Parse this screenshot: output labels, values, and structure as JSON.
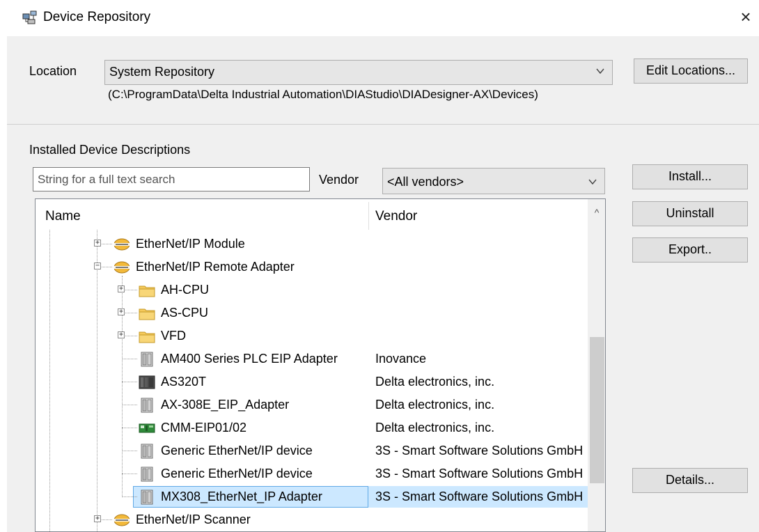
{
  "window": {
    "title": "Device Repository",
    "close_glyph": "×",
    "icon": "device-repository-icon"
  },
  "location": {
    "label": "Location",
    "selected": "System Repository",
    "path": "(C:\\ProgramData\\Delta Industrial Automation\\DIAStudio\\DIADesigner-AX\\Devices)",
    "edit_button": "Edit Locations..."
  },
  "installed": {
    "section_label": "Installed Device Descriptions",
    "search_placeholder": "String for a full text search",
    "vendor_label": "Vendor",
    "vendor_selected": "<All vendors>"
  },
  "buttons": {
    "install": "Install...",
    "uninstall": "Uninstall",
    "export": "Export..",
    "details": "Details..."
  },
  "tree": {
    "columns": {
      "name": "Name",
      "vendor": "Vendor"
    },
    "rows": [
      {
        "label": "EtherNet/IP Module",
        "vendor": "",
        "icon": "ethernet-ip-icon",
        "expander": "+"
      },
      {
        "label": "EtherNet/IP Remote Adapter",
        "vendor": "",
        "icon": "ethernet-ip-icon",
        "expander": "-"
      },
      {
        "label": "AH-CPU",
        "vendor": "",
        "icon": "folder-icon",
        "expander": "+"
      },
      {
        "label": "AS-CPU",
        "vendor": "",
        "icon": "folder-icon",
        "expander": "+"
      },
      {
        "label": "VFD",
        "vendor": "",
        "icon": "folder-icon",
        "expander": "+"
      },
      {
        "label": "AM400 Series PLC EIP Adapter",
        "vendor": "Inovance",
        "icon": "device-module-icon",
        "expander": ""
      },
      {
        "label": "AS320T",
        "vendor": "Delta electronics, inc.",
        "icon": "plc-dark-icon",
        "expander": ""
      },
      {
        "label": "AX-308E_EIP_Adapter",
        "vendor": "Delta electronics, inc.",
        "icon": "device-module-icon",
        "expander": ""
      },
      {
        "label": "CMM-EIP01/02",
        "vendor": "Delta electronics, inc.",
        "icon": "card-module-icon",
        "expander": ""
      },
      {
        "label": "Generic EtherNet/IP device",
        "vendor": "3S - Smart Software Solutions GmbH",
        "icon": "device-module-icon",
        "expander": ""
      },
      {
        "label": "Generic EtherNet/IP device",
        "vendor": "3S - Smart Software Solutions GmbH",
        "icon": "device-module-icon",
        "expander": ""
      },
      {
        "label": "MX308_EtherNet_IP Adapter",
        "vendor": "3S - Smart Software Solutions GmbH",
        "icon": "device-module-icon",
        "expander": "",
        "selected": true
      },
      {
        "label": "EtherNet/IP Scanner",
        "vendor": "",
        "icon": "ethernet-ip-icon",
        "expander": "+"
      }
    ]
  },
  "colors": {
    "panel_bg": "#f0f0f0",
    "selection_bg": "#cce8ff",
    "selection_border": "#5fa8e6",
    "folder": "#f5c95a"
  }
}
